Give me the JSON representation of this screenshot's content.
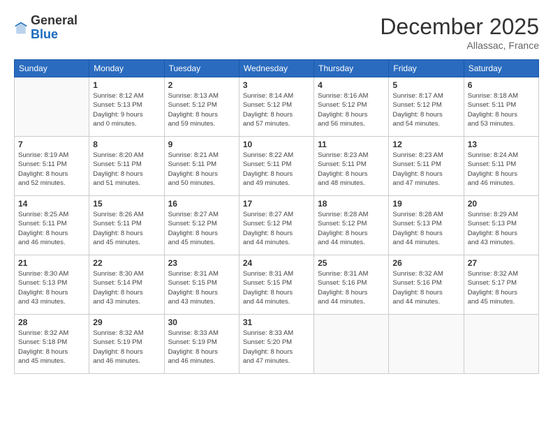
{
  "header": {
    "logo_general": "General",
    "logo_blue": "Blue",
    "month_title": "December 2025",
    "location": "Allassac, France"
  },
  "weekdays": [
    "Sunday",
    "Monday",
    "Tuesday",
    "Wednesday",
    "Thursday",
    "Friday",
    "Saturday"
  ],
  "weeks": [
    [
      {
        "day": "",
        "info": ""
      },
      {
        "day": "1",
        "info": "Sunrise: 8:12 AM\nSunset: 5:13 PM\nDaylight: 9 hours\nand 0 minutes."
      },
      {
        "day": "2",
        "info": "Sunrise: 8:13 AM\nSunset: 5:12 PM\nDaylight: 8 hours\nand 59 minutes."
      },
      {
        "day": "3",
        "info": "Sunrise: 8:14 AM\nSunset: 5:12 PM\nDaylight: 8 hours\nand 57 minutes."
      },
      {
        "day": "4",
        "info": "Sunrise: 8:16 AM\nSunset: 5:12 PM\nDaylight: 8 hours\nand 56 minutes."
      },
      {
        "day": "5",
        "info": "Sunrise: 8:17 AM\nSunset: 5:12 PM\nDaylight: 8 hours\nand 54 minutes."
      },
      {
        "day": "6",
        "info": "Sunrise: 8:18 AM\nSunset: 5:11 PM\nDaylight: 8 hours\nand 53 minutes."
      }
    ],
    [
      {
        "day": "7",
        "info": "Sunrise: 8:19 AM\nSunset: 5:11 PM\nDaylight: 8 hours\nand 52 minutes."
      },
      {
        "day": "8",
        "info": "Sunrise: 8:20 AM\nSunset: 5:11 PM\nDaylight: 8 hours\nand 51 minutes."
      },
      {
        "day": "9",
        "info": "Sunrise: 8:21 AM\nSunset: 5:11 PM\nDaylight: 8 hours\nand 50 minutes."
      },
      {
        "day": "10",
        "info": "Sunrise: 8:22 AM\nSunset: 5:11 PM\nDaylight: 8 hours\nand 49 minutes."
      },
      {
        "day": "11",
        "info": "Sunrise: 8:23 AM\nSunset: 5:11 PM\nDaylight: 8 hours\nand 48 minutes."
      },
      {
        "day": "12",
        "info": "Sunrise: 8:23 AM\nSunset: 5:11 PM\nDaylight: 8 hours\nand 47 minutes."
      },
      {
        "day": "13",
        "info": "Sunrise: 8:24 AM\nSunset: 5:11 PM\nDaylight: 8 hours\nand 46 minutes."
      }
    ],
    [
      {
        "day": "14",
        "info": "Sunrise: 8:25 AM\nSunset: 5:11 PM\nDaylight: 8 hours\nand 46 minutes."
      },
      {
        "day": "15",
        "info": "Sunrise: 8:26 AM\nSunset: 5:11 PM\nDaylight: 8 hours\nand 45 minutes."
      },
      {
        "day": "16",
        "info": "Sunrise: 8:27 AM\nSunset: 5:12 PM\nDaylight: 8 hours\nand 45 minutes."
      },
      {
        "day": "17",
        "info": "Sunrise: 8:27 AM\nSunset: 5:12 PM\nDaylight: 8 hours\nand 44 minutes."
      },
      {
        "day": "18",
        "info": "Sunrise: 8:28 AM\nSunset: 5:12 PM\nDaylight: 8 hours\nand 44 minutes."
      },
      {
        "day": "19",
        "info": "Sunrise: 8:28 AM\nSunset: 5:13 PM\nDaylight: 8 hours\nand 44 minutes."
      },
      {
        "day": "20",
        "info": "Sunrise: 8:29 AM\nSunset: 5:13 PM\nDaylight: 8 hours\nand 43 minutes."
      }
    ],
    [
      {
        "day": "21",
        "info": "Sunrise: 8:30 AM\nSunset: 5:13 PM\nDaylight: 8 hours\nand 43 minutes."
      },
      {
        "day": "22",
        "info": "Sunrise: 8:30 AM\nSunset: 5:14 PM\nDaylight: 8 hours\nand 43 minutes."
      },
      {
        "day": "23",
        "info": "Sunrise: 8:31 AM\nSunset: 5:15 PM\nDaylight: 8 hours\nand 43 minutes."
      },
      {
        "day": "24",
        "info": "Sunrise: 8:31 AM\nSunset: 5:15 PM\nDaylight: 8 hours\nand 44 minutes."
      },
      {
        "day": "25",
        "info": "Sunrise: 8:31 AM\nSunset: 5:16 PM\nDaylight: 8 hours\nand 44 minutes."
      },
      {
        "day": "26",
        "info": "Sunrise: 8:32 AM\nSunset: 5:16 PM\nDaylight: 8 hours\nand 44 minutes."
      },
      {
        "day": "27",
        "info": "Sunrise: 8:32 AM\nSunset: 5:17 PM\nDaylight: 8 hours\nand 45 minutes."
      }
    ],
    [
      {
        "day": "28",
        "info": "Sunrise: 8:32 AM\nSunset: 5:18 PM\nDaylight: 8 hours\nand 45 minutes."
      },
      {
        "day": "29",
        "info": "Sunrise: 8:32 AM\nSunset: 5:19 PM\nDaylight: 8 hours\nand 46 minutes."
      },
      {
        "day": "30",
        "info": "Sunrise: 8:33 AM\nSunset: 5:19 PM\nDaylight: 8 hours\nand 46 minutes."
      },
      {
        "day": "31",
        "info": "Sunrise: 8:33 AM\nSunset: 5:20 PM\nDaylight: 8 hours\nand 47 minutes."
      },
      {
        "day": "",
        "info": ""
      },
      {
        "day": "",
        "info": ""
      },
      {
        "day": "",
        "info": ""
      }
    ]
  ]
}
